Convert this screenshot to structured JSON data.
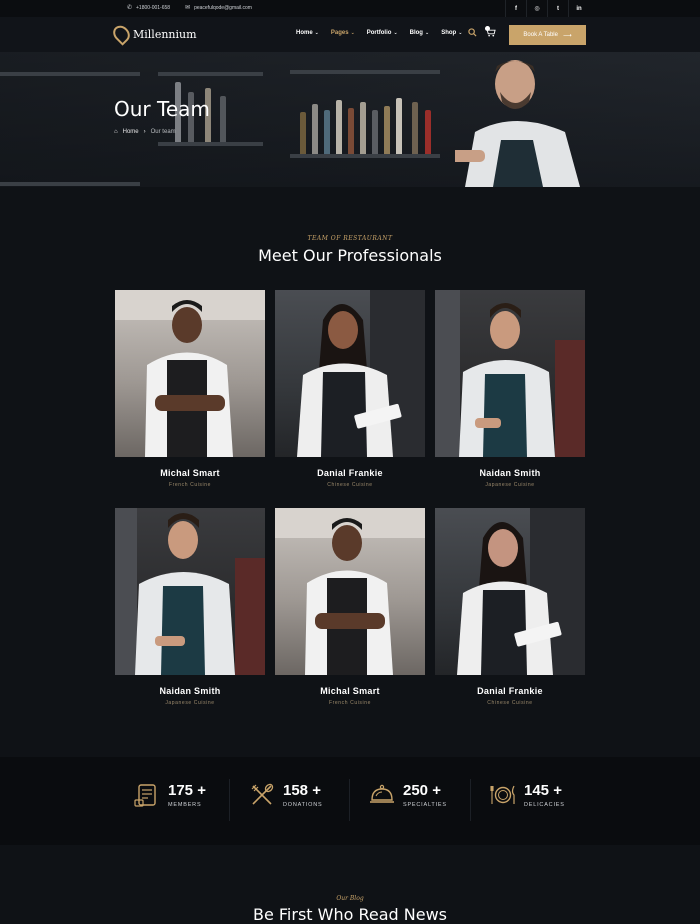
{
  "topbar": {
    "phone": "+1800-001-658",
    "email": "peacefulqode@gmail.com",
    "social_icons": [
      "facebook-icon",
      "instagram-icon",
      "twitter-icon",
      "linkedin-icon"
    ]
  },
  "nav": {
    "logo": "Millennium",
    "menu": [
      {
        "label": "Home",
        "active": false
      },
      {
        "label": "Pages",
        "active": true
      },
      {
        "label": "Portfolio",
        "active": false
      },
      {
        "label": "Blog",
        "active": false
      },
      {
        "label": "Shop",
        "active": false
      }
    ],
    "cta": "Book A Table"
  },
  "hero": {
    "title": "Our Team",
    "breadcrumb_home": "Home",
    "breadcrumb_current": "Our team"
  },
  "team": {
    "eyebrow": "TEAM OF RESTAURANT",
    "heading": "Meet Our Professionals",
    "members": [
      {
        "name": "Michal Smart",
        "role": "French Cuisine"
      },
      {
        "name": "Danial Frankie",
        "role": "Chinese Cuisine"
      },
      {
        "name": "Naidan Smith",
        "role": "Japanese Cuisine"
      },
      {
        "name": "Naidan Smith",
        "role": "Japanese Cuisine"
      },
      {
        "name": "Michal Smart",
        "role": "French Cuisine"
      },
      {
        "name": "Danial Frankie",
        "role": "Chinese Cuisine"
      }
    ]
  },
  "stats": [
    {
      "value": "175 +",
      "label": "MEMBERS",
      "icon": "certificate-icon"
    },
    {
      "value": "158 +",
      "label": "DONATIONS",
      "icon": "utensils-icon"
    },
    {
      "value": "250 +",
      "label": "SPECIALTIES",
      "icon": "cloche-icon"
    },
    {
      "value": "145 +",
      "label": "DELICACIES",
      "icon": "plate-cutlery-icon"
    }
  ],
  "blog": {
    "eyebrow": "Our Blog",
    "heading": "Be First Who Read News"
  },
  "colors": {
    "accent": "#c9a46a",
    "background": "#0f1216",
    "stats_bg": "#0a0c0f"
  }
}
